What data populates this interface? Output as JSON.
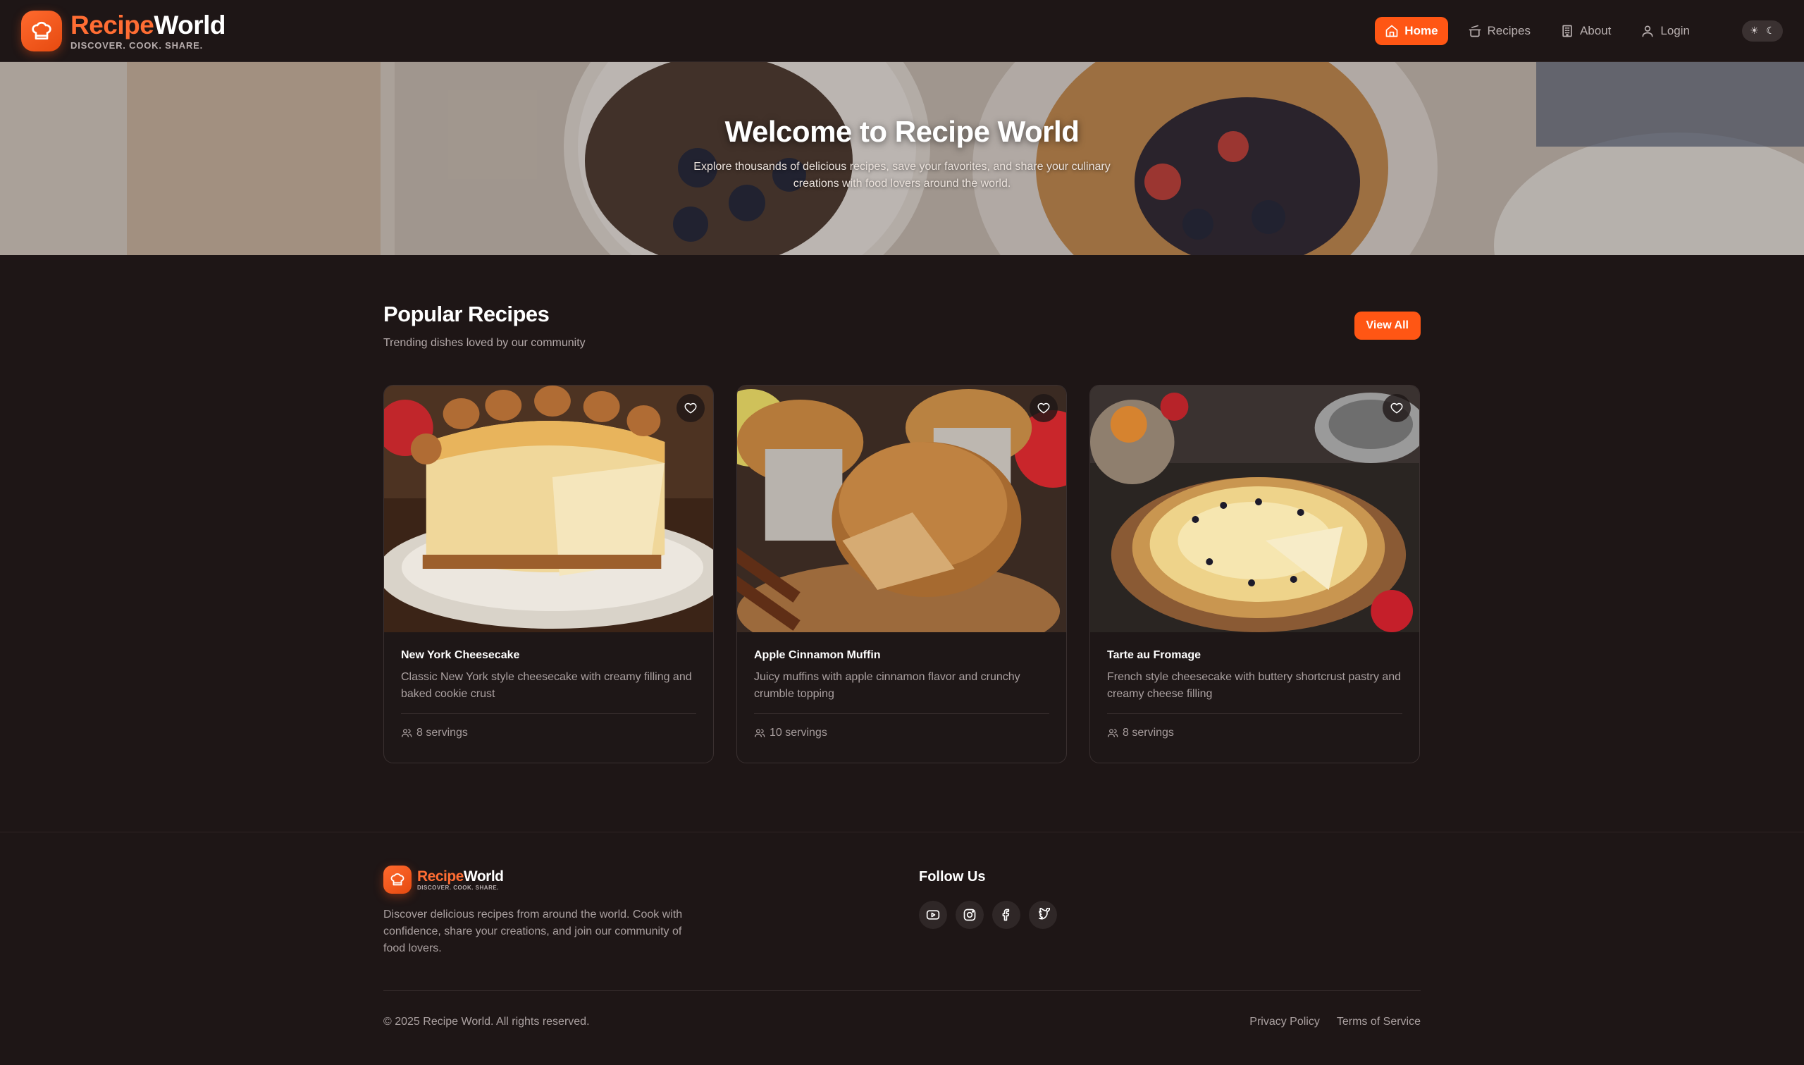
{
  "colors": {
    "accent": "#ff5614",
    "background": "#1e1616",
    "card": "#1e1717"
  },
  "brand": {
    "name_part1": "Recipe",
    "name_part2": "World",
    "tagline": "DISCOVER. COOK. SHARE."
  },
  "nav": {
    "items": [
      {
        "label": "Home",
        "icon": "home-icon",
        "active": true
      },
      {
        "label": "Recipes",
        "icon": "cooking-pot-icon",
        "active": false
      },
      {
        "label": "About",
        "icon": "building-icon",
        "active": false
      },
      {
        "label": "Login",
        "icon": "user-icon",
        "active": false
      }
    ],
    "theme_toggle": {
      "light": "☀",
      "dark": "☾"
    }
  },
  "hero": {
    "title": "Welcome to Recipe World",
    "subtitle": "Explore thousands of delicious recipes, save your favorites, and share your culinary creations with food lovers around the world."
  },
  "popular": {
    "title": "Popular Recipes",
    "subtitle": "Trending dishes loved by our community",
    "view_all": "View All",
    "cards": [
      {
        "title": "New York Cheesecake",
        "description": "Classic New York style cheesecake with creamy filling and baked cookie crust",
        "servings": "8 servings"
      },
      {
        "title": "Apple Cinnamon Muffin",
        "description": "Juicy muffins with apple cinnamon flavor and crunchy crumble topping",
        "servings": "10 servings"
      },
      {
        "title": "Tarte au Fromage",
        "description": "French style cheesecake with buttery shortcrust pastry and creamy cheese filling",
        "servings": "8 servings"
      }
    ]
  },
  "footer": {
    "description": "Discover delicious recipes from around the world. Cook with confidence, share your creations, and join our community of food lovers.",
    "follow_title": "Follow Us",
    "socials": [
      "youtube-icon",
      "instagram-icon",
      "facebook-icon",
      "twitter-icon"
    ],
    "copyright": "© 2025 Recipe World. All rights reserved.",
    "links": [
      "Privacy Policy",
      "Terms of Service"
    ]
  }
}
